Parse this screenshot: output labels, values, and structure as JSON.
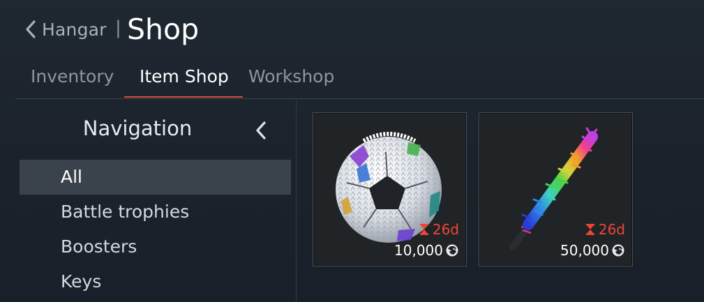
{
  "header": {
    "back_label": "Hangar",
    "separator": "|",
    "title": "Shop"
  },
  "tabs": [
    {
      "label": "Inventory",
      "active": false
    },
    {
      "label": "Item Shop",
      "active": true
    },
    {
      "label": "Workshop",
      "active": false
    }
  ],
  "sidebar": {
    "title": "Navigation",
    "items": [
      {
        "label": "All",
        "selected": true
      },
      {
        "label": "Battle trophies",
        "selected": false
      },
      {
        "label": "Boosters",
        "selected": false
      },
      {
        "label": "Keys",
        "selected": false
      }
    ]
  },
  "items": [
    {
      "art": "soccer-ball-pinata",
      "timer": "26d",
      "price": "10,000",
      "currency_icon": "lion-icon"
    },
    {
      "art": "rainbow-pinata-stick",
      "timer": "26d",
      "price": "50,000",
      "currency_icon": "lion-icon"
    }
  ],
  "colors": {
    "background": "#1d242d",
    "accent": "#d8503a",
    "timer": "#f04535",
    "selected_row": "#3a424b",
    "card_background": "#202427"
  }
}
